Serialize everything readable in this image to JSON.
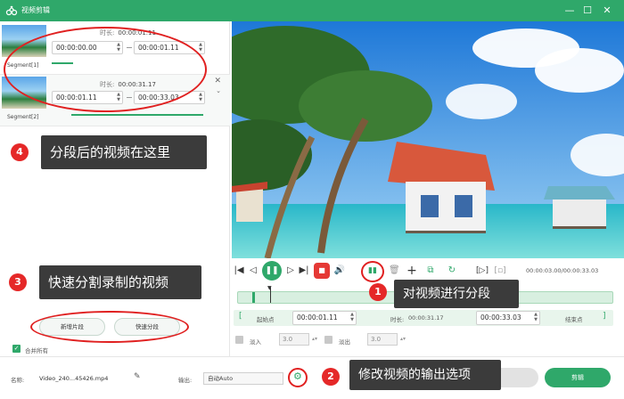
{
  "window": {
    "title": "视频剪辑",
    "buttons": {
      "minimize": "—",
      "maximize": "☐",
      "close": "✕"
    }
  },
  "segments": [
    {
      "label": "Segment[1]",
      "duration_label": "时长:",
      "duration": "00:00:01.11",
      "start": "00:00:00.00",
      "end": "00:00:01.11"
    },
    {
      "label": "Segment[2]",
      "duration_label": "时长:",
      "duration": "00:00:31.17",
      "start": "00:00:01.11",
      "end": "00:00:33.03"
    }
  ],
  "annotations": [
    {
      "num": "1",
      "text": "对视频进行分段"
    },
    {
      "num": "2",
      "text": "修改视频的输出选项"
    },
    {
      "num": "3",
      "text": "快速分割录制的视频"
    },
    {
      "num": "4",
      "text": "分段后的视频在这里"
    }
  ],
  "left_actions": {
    "new_segment": "新增片段",
    "quick_split": "快速分段",
    "merge_all": "合并所有"
  },
  "playback": {
    "time": "00:00:03.00/00:00:33.03"
  },
  "trim": {
    "start_label": "起始点",
    "start_value": "00:00:01.11",
    "duration_label": "时长:",
    "duration_value": "00:00:31.17",
    "end_value": "00:00:33.03",
    "end_label": "结束点"
  },
  "fade": {
    "fade_in_label": "淡入",
    "fade_in_value": "3.0",
    "fade_out_label": "淡出",
    "fade_out_value": "3.0"
  },
  "bottom": {
    "name_label": "名称:",
    "file_name": "Video_240...45426.mp4",
    "output_label": "输出:",
    "output_value": "自动Auto",
    "cut_button": "剪辑"
  },
  "icons": [
    "app-logo-icon",
    "pencil-icon",
    "gear-icon",
    "play-icon",
    "stop-icon",
    "volume-icon",
    "split-icon",
    "delete-icon",
    "add-icon",
    "copy-icon",
    "reset-icon",
    "crop-icon",
    "close-icon"
  ],
  "colors": {
    "accent": "#2fa86a",
    "annotation_red": "#e52828",
    "tip_bg": "#3b3b3b",
    "stop_red": "#e53935"
  }
}
